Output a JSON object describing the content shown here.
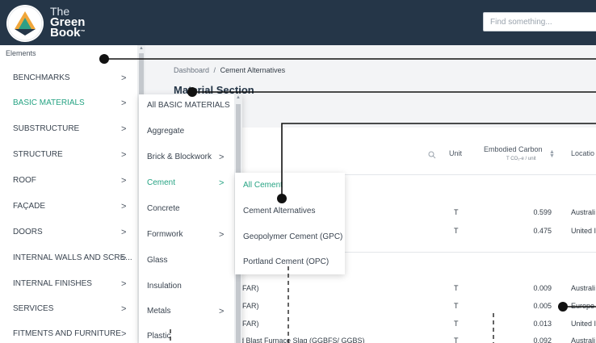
{
  "logo": {
    "line1": "The",
    "line2": "Green",
    "line3": "Book",
    "mark": "™"
  },
  "search": {
    "placeholder": "Find something..."
  },
  "breadcrumb": {
    "home": "Dashboard",
    "sep": "/",
    "current": "Cement Alternatives"
  },
  "section": {
    "title": "Material Section"
  },
  "sidebar": {
    "heading": "Elements",
    "items": [
      {
        "label": "BENCHMARKS",
        "chev": ">"
      },
      {
        "label": "BASIC MATERIALS",
        "chev": ">"
      },
      {
        "label": "SUBSTRUCTURE",
        "chev": ">"
      },
      {
        "label": "STRUCTURE",
        "chev": ">"
      },
      {
        "label": "ROOF",
        "chev": ">"
      },
      {
        "label": "FAÇADE",
        "chev": ">"
      },
      {
        "label": "DOORS",
        "chev": ">"
      },
      {
        "label": "INTERNAL WALLS AND SCRE...",
        "chev": ">"
      },
      {
        "label": "INTERNAL FINISHES",
        "chev": ">"
      },
      {
        "label": "SERVICES",
        "chev": ">"
      },
      {
        "label": "FITMENTS AND FURNITURE",
        "chev": ">"
      }
    ]
  },
  "submenu": {
    "items": [
      {
        "label": "All BASIC MATERIALS",
        "chev": ""
      },
      {
        "label": "Aggregate",
        "chev": ""
      },
      {
        "label": "Brick & Blockwork",
        "chev": ">"
      },
      {
        "label": "Cement",
        "chev": ">"
      },
      {
        "label": "Concrete",
        "chev": ""
      },
      {
        "label": "Formwork",
        "chev": ">"
      },
      {
        "label": "Glass",
        "chev": ""
      },
      {
        "label": "Insulation",
        "chev": ""
      },
      {
        "label": "Metals",
        "chev": ">"
      },
      {
        "label": "Plastic",
        "chev": ""
      }
    ]
  },
  "cement_menu": {
    "items": [
      {
        "label": "All Cement"
      },
      {
        "label": "Cement Alternatives"
      },
      {
        "label": "Geopolymer Cement (GPC)"
      },
      {
        "label": "Portland Cement (OPC)"
      }
    ]
  },
  "table": {
    "columns": {
      "unit": "Unit",
      "embodied": "Embodied Carbon",
      "embodied_unit": "T CO₂-e / unit",
      "location": "Locatio"
    },
    "rows": [
      {
        "name": "",
        "unit": "T",
        "value": "0.599",
        "location": "Australi"
      },
      {
        "name": "",
        "unit": "T",
        "value": "0.475",
        "location": "United I"
      },
      {
        "name": "(FAR)",
        "unit": "T",
        "value": "0.009",
        "location": "Australi"
      },
      {
        "name": "(FAR)",
        "unit": "T",
        "value": "0.005",
        "location": "Europe"
      },
      {
        "name": "(FAR)",
        "unit": "T",
        "value": "0.013",
        "location": "United I"
      },
      {
        "name": "d Blast Furnace Slag (GGBFS/ GGBS)",
        "unit": "T",
        "value": "0.092",
        "location": "Australi"
      }
    ]
  },
  "icons": {
    "search": "search-icon",
    "sort": "sort-icon",
    "chevron": "chevron-right-icon"
  },
  "colors": {
    "topbar": "#253648",
    "accent": "#26a383"
  }
}
